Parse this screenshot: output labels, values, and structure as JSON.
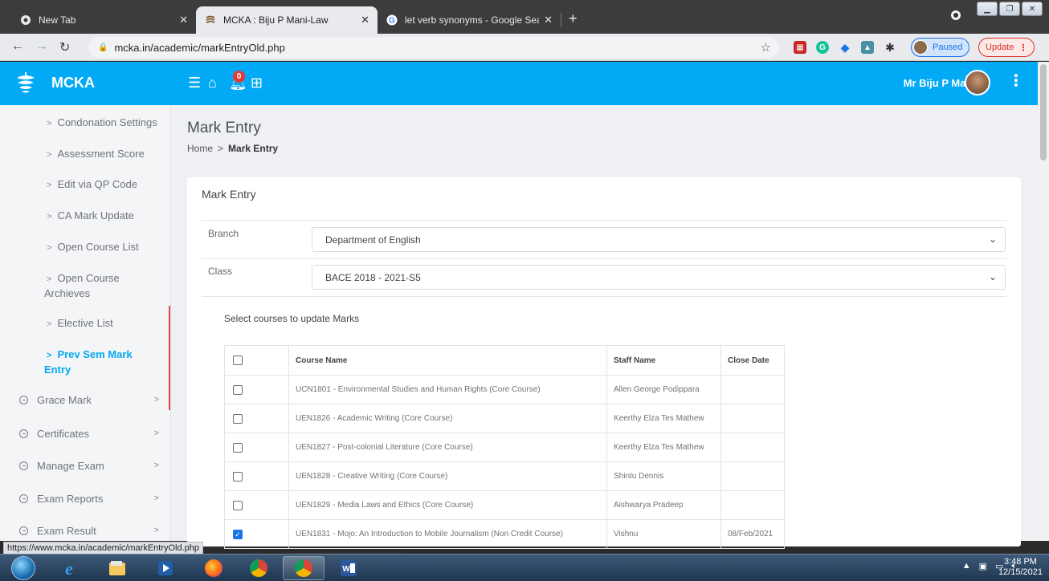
{
  "browser": {
    "tabs": [
      {
        "label": "New Tab",
        "icon": "new-tab-icon"
      },
      {
        "label": "MCKA : Biju P Mani-Law",
        "icon": "mcka-favicon"
      },
      {
        "label": "let verb synonyms - Google Sear",
        "icon": "google-icon"
      }
    ],
    "url": "mcka.in/academic/markEntryOld.php",
    "profile_status": "Paused",
    "update_label": "Update",
    "status_url": "https://www.mcka.in/academic/markEntryOld.php"
  },
  "app": {
    "brand": "MCKA",
    "notification_count": "0",
    "user_name": "Mr Biju P Mani",
    "accent": "#02a9f4"
  },
  "sidebar": {
    "sub_items": [
      {
        "label": "Condonation Settings"
      },
      {
        "label": "Assessment Score"
      },
      {
        "label": "Edit via QP Code"
      },
      {
        "label": "CA Mark Update"
      },
      {
        "label": "Open Course List"
      },
      {
        "label": "Open Course Archieves"
      },
      {
        "label": "Elective List"
      },
      {
        "label": "Prev Sem Mark Entry",
        "active": true
      }
    ],
    "main_items": [
      {
        "label": "Grace Mark"
      },
      {
        "label": "Certificates"
      },
      {
        "label": "Manage Exam"
      },
      {
        "label": "Exam Reports"
      },
      {
        "label": "Exam Result"
      }
    ]
  },
  "page": {
    "title": "Mark Entry",
    "breadcrumb": {
      "home": "Home",
      "current": "Mark Entry"
    },
    "card_title": "Mark Entry",
    "branch_label": "Branch",
    "branch_value": "Department of English",
    "class_label": "Class",
    "class_value": "BACE 2018 - 2021-S5",
    "select_hint": "Select courses to update Marks",
    "table": {
      "headers": [
        "Course Name",
        "Staff Name",
        "Close Date"
      ],
      "rows": [
        {
          "course": "UCN1801 - Environmental Studies and Human Rights (Core Course)",
          "staff": "Allen George Podippara",
          "close_date": "",
          "checked": false
        },
        {
          "course": "UEN1826 - Academic Writing (Core Course)",
          "staff": "Keerthy Elza Tes Mathew",
          "close_date": "",
          "checked": false
        },
        {
          "course": "UEN1827 - Post-colonial Literature (Core Course)",
          "staff": "Keerthy Elza Tes Mathew",
          "close_date": "",
          "checked": false
        },
        {
          "course": "UEN1828 - Creative Writing (Core Course)",
          "staff": "Shintu Dennis",
          "close_date": "",
          "checked": false
        },
        {
          "course": "UEN1829 - Media Laws and Ethics (Core Course)",
          "staff": "Aishwarya Pradeep",
          "close_date": "",
          "checked": false
        },
        {
          "course": "UEN1831 - Mojo: An Introduction to Mobile Journalism (Non Credit Course)",
          "staff": "Vishnu",
          "close_date": "08/Feb/2021",
          "checked": true
        }
      ]
    }
  },
  "taskbar": {
    "time": "3:48 PM",
    "date": "12/15/2021"
  }
}
